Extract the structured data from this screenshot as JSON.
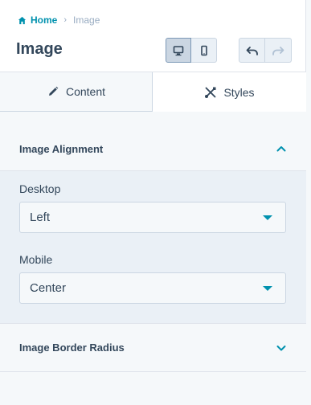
{
  "breadcrumb": {
    "home": "Home",
    "separator": "›",
    "current": "Image"
  },
  "title": "Image",
  "tabs": [
    {
      "label": "Content",
      "icon": "pencil-icon",
      "active": false
    },
    {
      "label": "Styles",
      "icon": "styles-icon",
      "active": true
    }
  ],
  "sections": {
    "alignment": {
      "title": "Image Alignment",
      "expanded": true,
      "fields": [
        {
          "label": "Desktop",
          "value": "Left"
        },
        {
          "label": "Mobile",
          "value": "Center"
        }
      ]
    },
    "border_radius": {
      "title": "Image Border Radius",
      "expanded": false
    }
  },
  "colors": {
    "accent": "#0091ae",
    "text": "#33475b",
    "muted": "#99acc2"
  }
}
